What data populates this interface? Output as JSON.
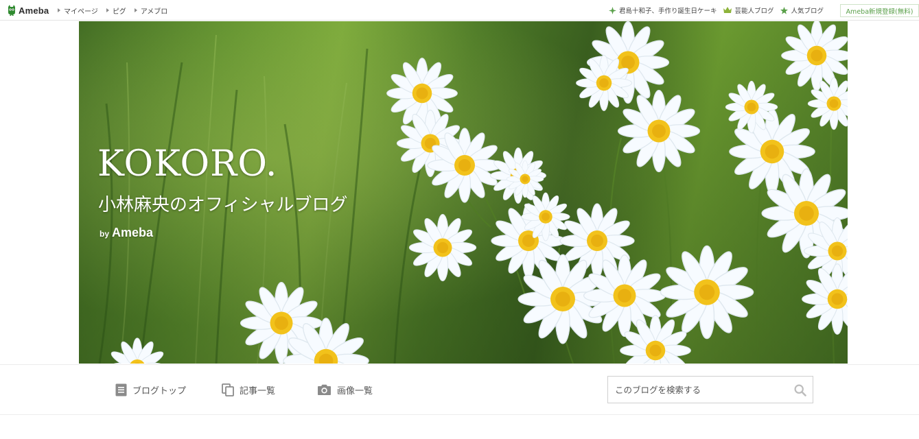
{
  "topbar": {
    "logo_text": "Ameba",
    "left_links": [
      "マイページ",
      "ピグ",
      "アメブロ"
    ],
    "right_links": [
      {
        "label": "君島十和子、手作り誕生日ケーキ",
        "icon": "sparkle-icon",
        "color": "#5aa04a"
      },
      {
        "label": "芸能人ブログ",
        "icon": "crown-icon",
        "color": "#8db33a"
      },
      {
        "label": "人気ブログ",
        "icon": "star-icon",
        "color": "#5aa04a"
      }
    ],
    "register_label": "Ameba新規登録(無料)"
  },
  "header": {
    "title": "KOKORO.",
    "subtitle": "小林麻央のオフィシャルブログ",
    "by": "by",
    "brand": "Ameba"
  },
  "blog_nav": {
    "items": [
      {
        "label": "ブログトップ",
        "icon": "document-icon"
      },
      {
        "label": "記事一覧",
        "icon": "copy-icon"
      },
      {
        "label": "画像一覧",
        "icon": "camera-icon"
      }
    ],
    "search_placeholder": "このブログを検索する"
  },
  "colors": {
    "accent_green": "#5aa04a",
    "icon_gray": "#8a8a8a"
  }
}
